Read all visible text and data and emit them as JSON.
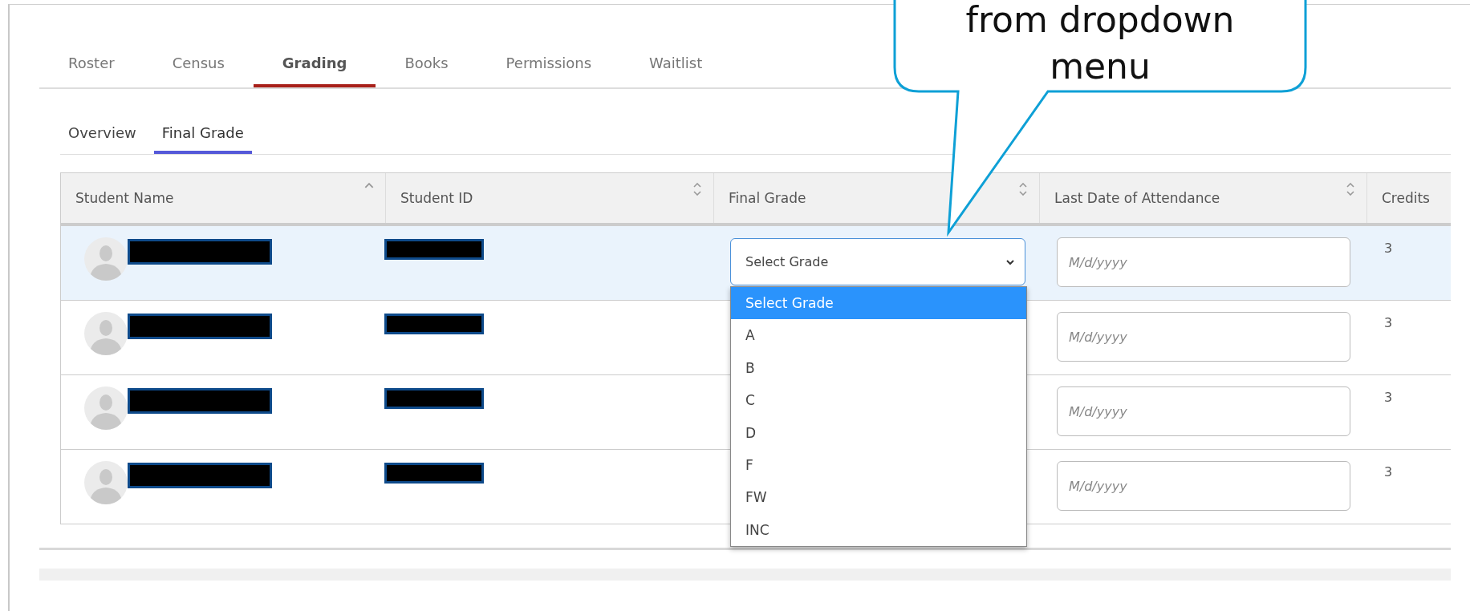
{
  "tabs": [
    {
      "label": "Roster",
      "selected": false
    },
    {
      "label": "Census",
      "selected": false
    },
    {
      "label": "Grading",
      "selected": true
    },
    {
      "label": "Books",
      "selected": false
    },
    {
      "label": "Permissions",
      "selected": false
    },
    {
      "label": "Waitlist",
      "selected": false
    }
  ],
  "subtabs": [
    {
      "label": "Overview",
      "selected": false
    },
    {
      "label": "Final Grade",
      "selected": true
    }
  ],
  "table": {
    "columns": [
      {
        "label": "Student Name",
        "sorted": true
      },
      {
        "label": "Student ID",
        "sorted": false
      },
      {
        "label": "Final Grade",
        "sorted": false
      },
      {
        "label": "Last Date of Attendance",
        "sorted": false
      },
      {
        "label": "Credits"
      }
    ],
    "rows": [
      {
        "selected": true,
        "final_grade": "Select Grade",
        "grade_dropdown": {
          "open": true,
          "options": [
            {
              "label": "Select Grade",
              "selected": true
            },
            {
              "label": "A",
              "selected": false
            },
            {
              "label": "B",
              "selected": false
            },
            {
              "label": "C",
              "selected": false
            },
            {
              "label": "D",
              "selected": false
            },
            {
              "label": "F",
              "selected": false
            },
            {
              "label": "FW",
              "selected": false
            },
            {
              "label": "INC",
              "selected": false
            }
          ]
        },
        "date_placeholder": "M/d/yyyy",
        "credits": "3"
      },
      {
        "selected": false,
        "date_placeholder": "M/d/yyyy",
        "credits": "3"
      },
      {
        "selected": false,
        "date_placeholder": "M/d/yyyy",
        "credits": "3"
      },
      {
        "selected": false,
        "date_placeholder": "M/d/yyyy",
        "credits": "3"
      }
    ]
  },
  "callout": {
    "lines": [
      "from dropdown",
      "menu"
    ]
  }
}
